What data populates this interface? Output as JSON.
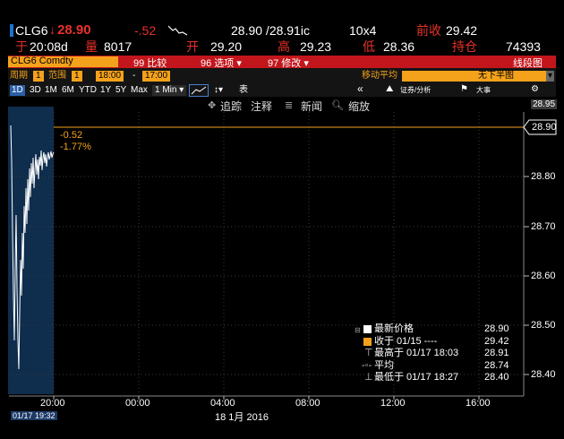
{
  "header": {
    "ticker": "CLG6",
    "last_price": "28.90",
    "change": "-.52",
    "bid_ask": "28.90 /28.91ic",
    "size": "10x4",
    "prev_close_label": "前收",
    "prev_close": "29.42",
    "time_label": "于",
    "time": "20:08d",
    "volume_label": "量",
    "volume": "8017",
    "open_label": "开",
    "open": "29.20",
    "high_label": "高",
    "high": "29.23",
    "low_label": "低",
    "low": "28.36",
    "oi_label": "持仓",
    "oi": "74393"
  },
  "menu": {
    "security": "CLG6 Comdty",
    "compare": "99 比较",
    "options": "96 选项 ▾",
    "edit": "97 修改 ▾",
    "chart_type": "线段图"
  },
  "toolbar": {
    "period_label": "周期",
    "period_value": "1",
    "range_label": "范围",
    "range_value": "1",
    "time_from": "18:00",
    "dash": "-",
    "time_to": "17:00",
    "moving_avg": "移动平均",
    "no_split": "无下半图",
    "ranges": [
      "1D",
      "3D",
      "1M",
      "6M",
      "YTD",
      "1Y",
      "5Y",
      "Max"
    ],
    "interval": "1 Min ▾",
    "table_icon_label": "表",
    "nav_back": "«",
    "analytics": "证券/分析",
    "events": "大事",
    "track": "追踪",
    "annotate": "注释",
    "news": "新闻",
    "zoom": "缩放"
  },
  "chart": {
    "current_tag": "28.95",
    "current_price_tag": "28.90",
    "change_annot": "-0.52",
    "pct_annot": "-1.77%",
    "y_ticks": [
      "28.80",
      "28.70",
      "28.60",
      "28.50",
      "28.40"
    ],
    "x_ticks": [
      "20:00",
      "00:00",
      "04:00",
      "08:00",
      "12:00",
      "16:00"
    ],
    "date_label": "18 1月 2016",
    "cursor_time": "01/17 19:32"
  },
  "legend": {
    "rows": [
      {
        "label": "最新价格",
        "value": "28.90"
      },
      {
        "label": "收于 01/15 ----",
        "value": "29.42"
      },
      {
        "label": "最高于 01/17 18:03",
        "value": "28.91"
      },
      {
        "label": "平均",
        "value": "28.74"
      },
      {
        "label": "最低于 01/17 18:27",
        "value": "28.40"
      }
    ]
  },
  "colors": {
    "accent_orange": "#f4a21b",
    "bar_red": "#c3161c",
    "down_red": "#e8312a",
    "shade_blue": "#0f2d4d"
  }
}
